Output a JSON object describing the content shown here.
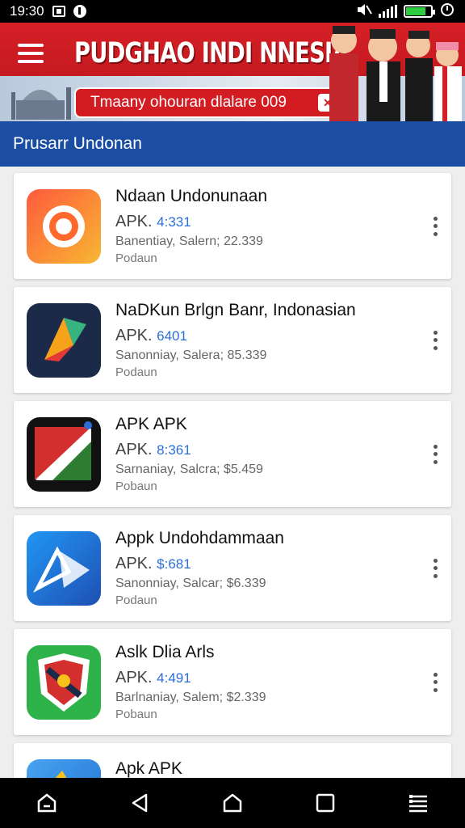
{
  "status_bar": {
    "time": "19:30",
    "icons": [
      "notification-icon",
      "info-icon",
      "mute-icon",
      "signal-icon",
      "battery-icon",
      "refresh-icon"
    ],
    "battery_color": "#2ecc40"
  },
  "banner": {
    "title": "PUDGHAO INDI NNESIA",
    "promo_text": "Tmaany ohouran dlalare 009",
    "bg_color": "#d61f26"
  },
  "subheader": {
    "title": "Prusarr Undonan",
    "bg_color": "#1b4ea3"
  },
  "apps": [
    {
      "name": "Ndaan Undonunaan",
      "ver_prefix": "APK.",
      "ver": "4:331",
      "meta": "Banentiay, Salern; 22.339",
      "sub": "Podaun",
      "icon": "camera-app-icon"
    },
    {
      "name": "NaDKun Brlgn Banr, Indonasian",
      "ver_prefix": "APK.",
      "ver": "6401",
      "meta": "Sanonniay, Salera; 85.339",
      "sub": "Podaun",
      "icon": "kite-app-icon"
    },
    {
      "name": "APK APK",
      "ver_prefix": "APK.",
      "ver": "8:361",
      "meta": "Sarnaniay, Salcra; $5.459",
      "sub": "Pobaun",
      "icon": "card-app-icon"
    },
    {
      "name": "Appk Undohdammaan",
      "ver_prefix": "APK.",
      "ver": "$:681",
      "meta": "Sanonniay, Salcar; $6.339",
      "sub": "Podaun",
      "icon": "triangle-app-icon"
    },
    {
      "name": "Aslk Dlia Arls",
      "ver_prefix": "APK.",
      "ver": "4:491",
      "meta": "Barlnaniay, Salem; $2.339",
      "sub": "Pobaun",
      "icon": "shield-app-icon"
    },
    {
      "name": "Apk APK",
      "ver_prefix": "",
      "ver": "",
      "meta": "",
      "sub": "",
      "icon": "cloud-app-icon"
    }
  ],
  "nav": [
    "recents-alt-icon",
    "back-icon",
    "home-icon",
    "overview-icon",
    "menu-lines-icon"
  ]
}
